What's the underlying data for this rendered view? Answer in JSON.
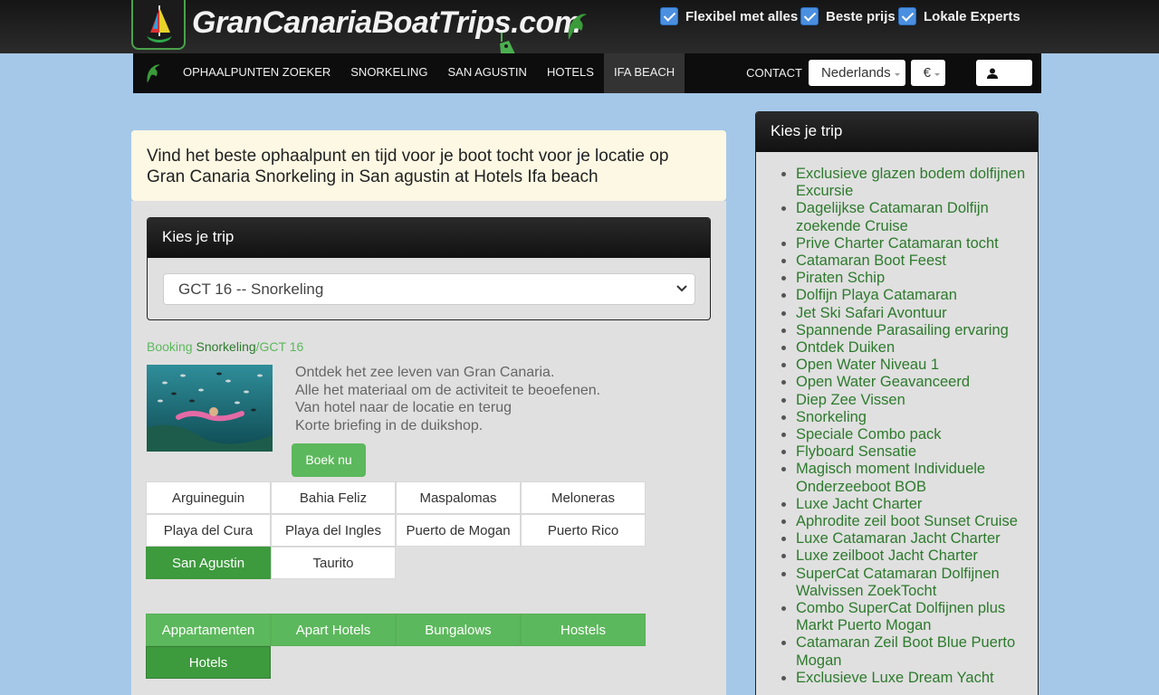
{
  "site": {
    "logo_text": "GranCanariaBoatTrips.com",
    "trust": [
      "Flexibel met alles",
      "Beste prijs",
      "Lokale Experts"
    ]
  },
  "nav": {
    "items": [
      "Ophaalpunten zoeker",
      "Snorkeling",
      "San Agustin",
      "Hotels",
      "Ifa Beach"
    ],
    "active_index": 4,
    "contact": "CONTACT",
    "language": "Nederlands",
    "currency": "€"
  },
  "headline": "Vind het beste ophaalpunt en tijd voor je boot tocht voor je locatie op Gran Canaria Snorkeling in San agustin at Hotels Ifa beach",
  "trip_panel": {
    "title": "Kies je trip",
    "selected": "GCT 16 -- Snorkeling"
  },
  "breadcrumb": {
    "booking": "Booking",
    "category": "Snorkeling",
    "code": "/GCT 16"
  },
  "product": {
    "lines": [
      "Ontdek het zee leven van Gran Canaria.",
      "Alle het materiaal om de activiteit te beoefenen.",
      "Van hotel naar de locatie en terug",
      "Korte briefing in de duikshop."
    ],
    "book_label": "Boek nu"
  },
  "locations": [
    "Arguineguin",
    "Bahia Feliz",
    "Maspalomas",
    "Meloneras",
    "Playa del Cura",
    "Playa del Ingles",
    "Puerto de Mogan",
    "Puerto Rico",
    "San Agustin",
    "Taurito"
  ],
  "active_location": "San Agustin",
  "accommodation_types": [
    "Appartamenten",
    "Apart Hotels",
    "Bungalows",
    "Hostels",
    "Hotels"
  ],
  "active_type": "Hotels",
  "sidebar": {
    "title": "Kies je trip",
    "trips": [
      "Exclusieve glazen bodem dolfijnen Excursie",
      "Dagelijkse Catamaran Dolfijn zoekende Cruise",
      "Prive Charter Catamaran tocht",
      "Catamaran Boot Feest",
      "Piraten Schip",
      "Dolfijn Playa Catamaran",
      "Jet Ski Safari Avontuur",
      "Spannende Parasailing ervaring",
      "Ontdek Duiken",
      "Open Water Niveau 1",
      "Open Water Geavanceerd",
      "Diep Zee Vissen",
      "Snorkeling",
      "Speciale Combo pack",
      "Flyboard Sensatie",
      "Magisch moment Individuele Onderzeeboot BOB",
      "Luxe Jacht Charter",
      "Aphrodite zeil boot Sunset Cruise",
      "Luxe Catamaran Jacht Charter",
      "Luxe zeilboot Jacht Charter",
      "SuperCat Catamaran Dolfijnen Walvissen ZoekTocht",
      "Combo SuperCat Dolfijnen plus Markt Puerto Mogan",
      "Catamaran Zeil Boot Blue Puerto Mogan",
      "Exclusieve Luxe Dream Yacht"
    ]
  },
  "colors": {
    "green": "#5cb85c",
    "green_active": "#3d9a3d",
    "link_green": "#2d7a2d",
    "background": "#a6c8e8",
    "headline_bg": "#fcf8e3"
  }
}
